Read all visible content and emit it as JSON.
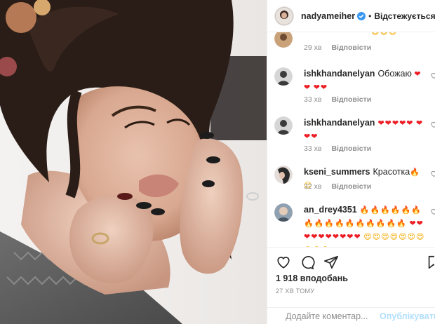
{
  "post": {
    "username": "nadyameiher",
    "separator": "•",
    "follow_status": "Відстежується"
  },
  "comments": [
    {
      "username": "",
      "text": "",
      "emoji": [
        {
          "kind": "smile",
          "glyph": "😄😄😄"
        }
      ],
      "time": "29 хв",
      "reply": "Відповісти",
      "avatar_color": "#c9a27a"
    },
    {
      "username": "ishkhandanelyan",
      "text": "Обожаю",
      "emoji": [
        {
          "kind": "heart",
          "glyph": "❤❤"
        },
        {
          "kind": "heart",
          "glyph": "❤❤"
        }
      ],
      "time": "33 хв",
      "reply": "Відповісти",
      "avatar_color": "#3b3b3b"
    },
    {
      "username": "ishkhandanelyan",
      "text": "",
      "emoji": [
        {
          "kind": "heart",
          "glyph": "❤❤❤❤❤"
        },
        {
          "kind": "heart",
          "glyph": "❤❤❤"
        }
      ],
      "time": "33 хв",
      "reply": "Відповісти",
      "avatar_color": "#3b3b3b"
    },
    {
      "username": "kseni_summers",
      "text": "Красотка",
      "emoji": [
        {
          "kind": "fire",
          "glyph": "🔥"
        },
        {
          "kind": "smile",
          "glyph": "😍"
        }
      ],
      "time": "32 хв",
      "reply": "Відповісти",
      "avatar_color": "#2a2a2a"
    },
    {
      "username": "an_drey4351",
      "text": "",
      "emoji": [
        {
          "kind": "fire",
          "glyph": "🔥🔥🔥🔥🔥🔥🔥🔥🔥🔥🔥🔥🔥🔥🔥🔥"
        },
        {
          "kind": "heart",
          "glyph": "❤❤❤❤❤❤❤❤❤❤"
        },
        {
          "kind": "smile",
          "glyph": "😍😍😍😍😍😍😍😍😍😍"
        }
      ],
      "time": "",
      "reply": "",
      "avatar_color": "#6b7b8b"
    }
  ],
  "stats": {
    "likes": "1 918 вподобань",
    "posted": "27 ХВ ТОМУ"
  },
  "composer": {
    "placeholder": "Додайте коментар...",
    "publish": "Опублікувати"
  },
  "colors": {
    "accent": "#3897f0",
    "verified": "#3897f0",
    "heart": "#ed1c24",
    "publish_disabled": "#b2dffc"
  },
  "icons": {
    "like": "heart-outline-icon",
    "comment": "speech-bubble-icon",
    "share": "paper-plane-icon",
    "save": "bookmark-icon",
    "emoji": "smiley-icon"
  }
}
